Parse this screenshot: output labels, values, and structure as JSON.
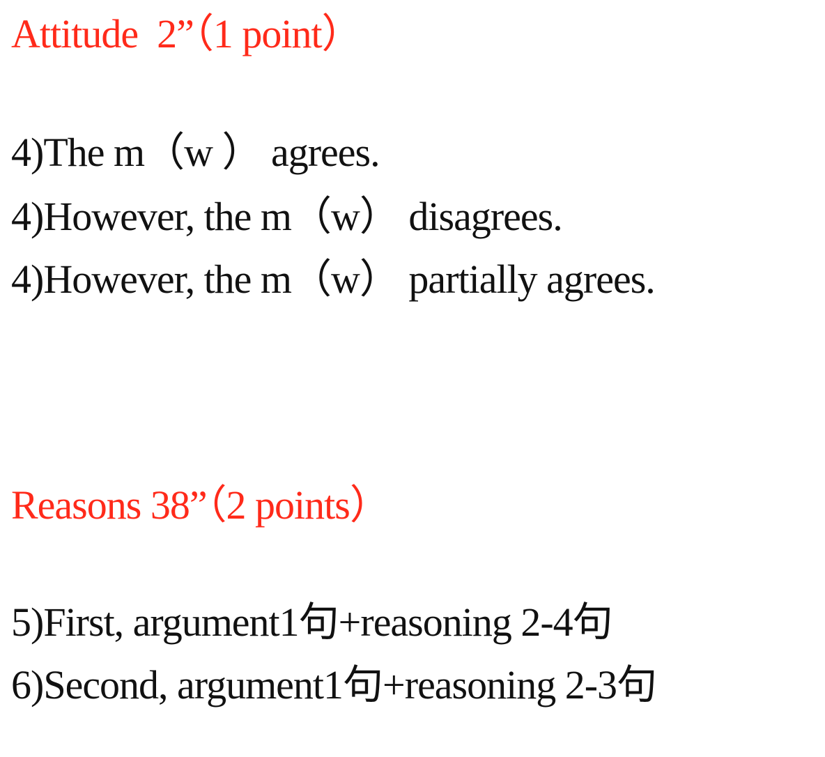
{
  "sections": [
    {
      "heading": "Attitude  2”（1 point）",
      "lines": [
        "4)The m（w ） agrees.",
        "4)However, the m（w） disagrees.",
        "4)However, the m（w） partially agrees."
      ]
    },
    {
      "heading": "Reasons 38”（2 points）",
      "lines": [
        "5)First, argument1句+reasoning 2-4句",
        "6)Second, argument1句+reasoning 2-3句"
      ]
    }
  ],
  "colors": {
    "heading": "#ff2a1a",
    "body_text": "#111111",
    "background": "#ffffff"
  }
}
